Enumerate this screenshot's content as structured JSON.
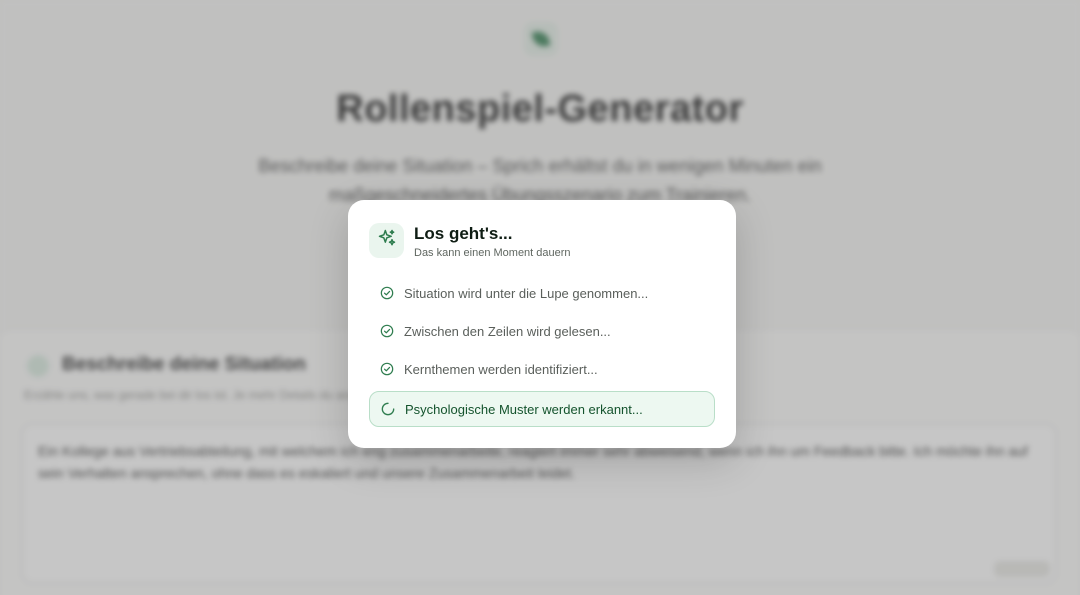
{
  "background": {
    "title": "Rollenspiel-Generator",
    "subtitle": "Beschreibe deine Situation – Sprich erhältst du in wenigen Minuten ein maßgeschneidertes Übungsszenario zum Trainieren.",
    "card_title": "Beschreibe deine Situation",
    "card_hint": "Erzähle uns, was gerade bei dir los ist. Je mehr Details du angibst, desto realistischer wird dein Rollenspiel.",
    "card_hint_tail": "",
    "textarea_text": "Ein Kollege aus Vertriebsabteilung, mit welchem ich eng zusammenarbeite, reagiert immer sehr abweisend, wenn ich ihn um Feedback bitte. Ich möchte ihn auf sein Verhalten ansprechen, ohne dass es eskaliert und unsere Zusammenarbeit leidet.",
    "submit_label": ""
  },
  "modal": {
    "icon": "sparkles-icon",
    "title": "Los geht's...",
    "subtitle": "Das kann einen Moment dauern",
    "steps": [
      {
        "label": "Situation wird unter die Lupe genommen...",
        "status": "done"
      },
      {
        "label": "Zwischen den Zeilen wird gelesen...",
        "status": "done"
      },
      {
        "label": "Kernthemen werden identifiziert...",
        "status": "done"
      },
      {
        "label": "Psychologische Muster werden erkannt...",
        "status": "active"
      }
    ]
  },
  "colors": {
    "accent": "#2f7d4f",
    "accent_light": "#edf8f1",
    "accent_border": "#b9dec8"
  }
}
